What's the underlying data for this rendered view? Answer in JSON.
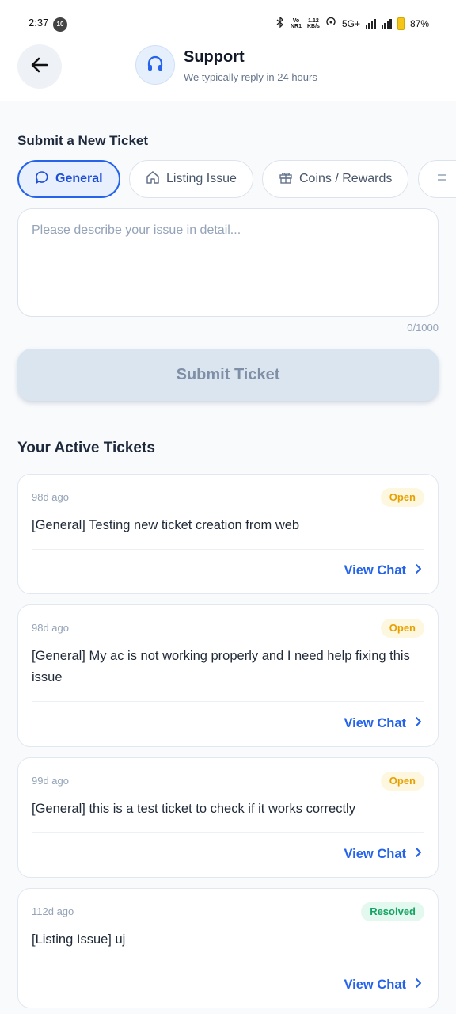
{
  "status_bar": {
    "time": "2:37",
    "badge": "10",
    "net_top": "Vo",
    "net_bottom": "NR1",
    "speed_top": "1.12",
    "speed_bottom": "KB/s",
    "network": "5G+",
    "battery": "87%"
  },
  "header": {
    "title": "Support",
    "subtitle": "We typically reply in 24 hours"
  },
  "new_ticket": {
    "title": "Submit a New Ticket",
    "categories": [
      {
        "label": "General",
        "icon": "chat-bubble-icon",
        "selected": true
      },
      {
        "label": "Listing Issue",
        "icon": "home-icon",
        "selected": false
      },
      {
        "label": "Coins / Rewards",
        "icon": "gift-icon",
        "selected": false
      },
      {
        "label": "",
        "icon": "more-icon",
        "selected": false
      }
    ],
    "placeholder": "Please describe your issue in detail...",
    "value": "",
    "counter": "0/1000",
    "submit_label": "Submit Ticket"
  },
  "active_tickets": {
    "title": "Your Active Tickets",
    "tickets": [
      {
        "time": "98d ago",
        "status": "Open",
        "title": "[General] Testing new ticket creation from web",
        "action": "View Chat"
      },
      {
        "time": "98d ago",
        "status": "Open",
        "title": "[General] My ac is not working properly and I need help fixing this issue",
        "action": "View Chat"
      },
      {
        "time": "99d ago",
        "status": "Open",
        "title": "[General] this is a test ticket to check if it works correctly",
        "action": "View Chat"
      },
      {
        "time": "112d ago",
        "status": "Resolved",
        "title": "[Listing Issue] uj",
        "action": "View Chat"
      }
    ]
  },
  "colors": {
    "accent": "#2563eb",
    "open": "#e6a100",
    "resolved": "#16a364"
  }
}
